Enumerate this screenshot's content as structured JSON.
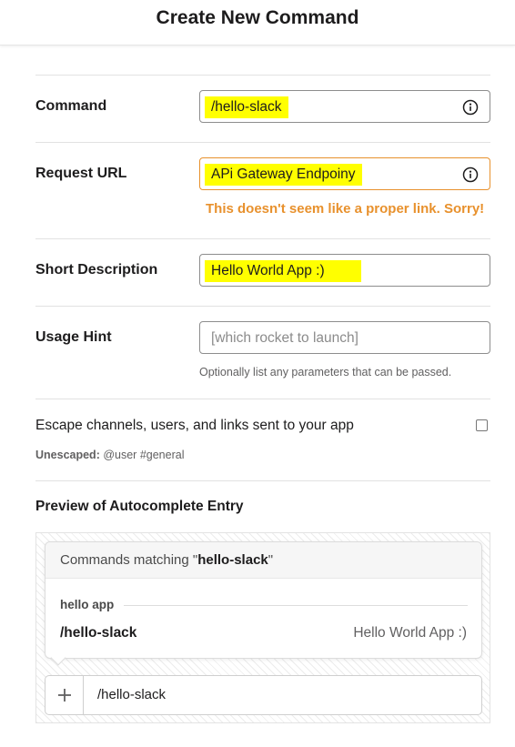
{
  "header": {
    "title": "Create New Command"
  },
  "form": {
    "command": {
      "label": "Command",
      "value": "/hello-slack"
    },
    "request_url": {
      "label": "Request URL",
      "value": "APi Gateway Endpoiny",
      "error": "This doesn't seem like a proper link. Sorry!"
    },
    "short_description": {
      "label": "Short Description",
      "value": "Hello World App :)"
    },
    "usage_hint": {
      "label": "Usage Hint",
      "placeholder": "[which rocket to launch]",
      "help": "Optionally list any parameters that can be passed."
    },
    "escape": {
      "label": "Escape channels, users, and links sent to your app",
      "checked": false,
      "unescaped_label": "Unescaped:",
      "unescaped_example": "@user #general"
    }
  },
  "preview": {
    "title": "Preview of Autocomplete Entry",
    "matching_prefix": "Commands matching \"",
    "matching_term": "hello-slack",
    "matching_suffix": "\"",
    "app_name": "hello app",
    "command": "/hello-slack",
    "description": "Hello World App :)",
    "message_text": "/hello-slack"
  },
  "colors": {
    "highlight": "#ffff00",
    "error": "#e8912d",
    "text": "#1d1c1d",
    "muted": "#616061"
  },
  "icons": {
    "info": "info-icon",
    "plus": "plus-icon"
  }
}
